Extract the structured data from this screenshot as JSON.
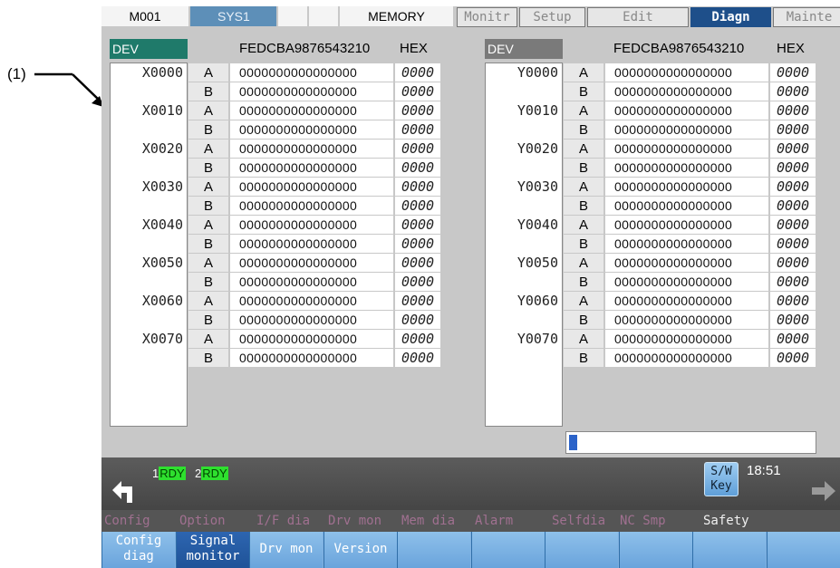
{
  "callout": "(1)",
  "header": {
    "model": "M001",
    "system": "SYS1",
    "mode": "MEMORY",
    "tabs": [
      "Monitr",
      "Setup",
      "Edit",
      "Diagn",
      "Mainte"
    ]
  },
  "left_table": {
    "dev_label": "DEV",
    "bits_header": "FEDCBA9876543210",
    "hex_header": "HEX",
    "rows": [
      {
        "addr": "X0000",
        "ab": "A",
        "bits": "0000000000000000",
        "hex": "0000"
      },
      {
        "addr": "",
        "ab": "B",
        "bits": "0000000000000000",
        "hex": "0000"
      },
      {
        "addr": "X0010",
        "ab": "A",
        "bits": "0000000000000000",
        "hex": "0000"
      },
      {
        "addr": "",
        "ab": "B",
        "bits": "0000000000000000",
        "hex": "0000"
      },
      {
        "addr": "X0020",
        "ab": "A",
        "bits": "0000000000000000",
        "hex": "0000"
      },
      {
        "addr": "",
        "ab": "B",
        "bits": "0000000000000000",
        "hex": "0000"
      },
      {
        "addr": "X0030",
        "ab": "A",
        "bits": "0000000000000000",
        "hex": "0000"
      },
      {
        "addr": "",
        "ab": "B",
        "bits": "0000000000000000",
        "hex": "0000"
      },
      {
        "addr": "X0040",
        "ab": "A",
        "bits": "0000000000000000",
        "hex": "0000"
      },
      {
        "addr": "",
        "ab": "B",
        "bits": "0000000000000000",
        "hex": "0000"
      },
      {
        "addr": "X0050",
        "ab": "A",
        "bits": "0000000000000000",
        "hex": "0000"
      },
      {
        "addr": "",
        "ab": "B",
        "bits": "0000000000000000",
        "hex": "0000"
      },
      {
        "addr": "X0060",
        "ab": "A",
        "bits": "0000000000000000",
        "hex": "0000"
      },
      {
        "addr": "",
        "ab": "B",
        "bits": "0000000000000000",
        "hex": "0000"
      },
      {
        "addr": "X0070",
        "ab": "A",
        "bits": "0000000000000000",
        "hex": "0000"
      },
      {
        "addr": "",
        "ab": "B",
        "bits": "0000000000000000",
        "hex": "0000"
      }
    ]
  },
  "right_table": {
    "dev_label": "DEV",
    "bits_header": "FEDCBA9876543210",
    "hex_header": "HEX",
    "rows": [
      {
        "addr": "Y0000",
        "ab": "A",
        "bits": "0000000000000000",
        "hex": "0000"
      },
      {
        "addr": "",
        "ab": "B",
        "bits": "0000000000000000",
        "hex": "0000"
      },
      {
        "addr": "Y0010",
        "ab": "A",
        "bits": "0000000000000000",
        "hex": "0000"
      },
      {
        "addr": "",
        "ab": "B",
        "bits": "0000000000000000",
        "hex": "0000"
      },
      {
        "addr": "Y0020",
        "ab": "A",
        "bits": "0000000000000000",
        "hex": "0000"
      },
      {
        "addr": "",
        "ab": "B",
        "bits": "0000000000000000",
        "hex": "0000"
      },
      {
        "addr": "Y0030",
        "ab": "A",
        "bits": "0000000000000000",
        "hex": "0000"
      },
      {
        "addr": "",
        "ab": "B",
        "bits": "0000000000000000",
        "hex": "0000"
      },
      {
        "addr": "Y0040",
        "ab": "A",
        "bits": "0000000000000000",
        "hex": "0000"
      },
      {
        "addr": "",
        "ab": "B",
        "bits": "0000000000000000",
        "hex": "0000"
      },
      {
        "addr": "Y0050",
        "ab": "A",
        "bits": "0000000000000000",
        "hex": "0000"
      },
      {
        "addr": "",
        "ab": "B",
        "bits": "0000000000000000",
        "hex": "0000"
      },
      {
        "addr": "Y0060",
        "ab": "A",
        "bits": "0000000000000000",
        "hex": "0000"
      },
      {
        "addr": "",
        "ab": "B",
        "bits": "0000000000000000",
        "hex": "0000"
      },
      {
        "addr": "Y0070",
        "ab": "A",
        "bits": "0000000000000000",
        "hex": "0000"
      },
      {
        "addr": "",
        "ab": "B",
        "bits": "0000000000000000",
        "hex": "0000"
      }
    ]
  },
  "status": {
    "sys1_num": "1",
    "sys1_rdy": "RDY",
    "sys2_num": "2",
    "sys2_rdy": "RDY",
    "sw_key_line1": "S/W",
    "sw_key_line2": "Key",
    "time": "18:51"
  },
  "menu": [
    "Config",
    "Option",
    "I/F dia",
    "Drv mon",
    "Mem dia",
    "Alarm",
    "Selfdia",
    "NC Smp",
    "Safety"
  ],
  "softkeys": [
    {
      "line1": "Config",
      "line2": "diag"
    },
    {
      "line1": "Signal",
      "line2": "monitor"
    },
    {
      "line1": "Drv mon",
      "line2": ""
    },
    {
      "line1": "Version",
      "line2": ""
    },
    {
      "line1": "",
      "line2": ""
    },
    {
      "line1": "",
      "line2": ""
    },
    {
      "line1": "",
      "line2": ""
    },
    {
      "line1": "",
      "line2": ""
    },
    {
      "line1": "",
      "line2": ""
    },
    {
      "line1": "",
      "line2": ""
    }
  ],
  "colors": {
    "active_tab": "#1e4f8a",
    "dev_header_left": "#1f7a6a",
    "dev_header_right": "#7a7a7a",
    "rdy": "#2ee02e",
    "softkey": "#6aa4dc"
  }
}
